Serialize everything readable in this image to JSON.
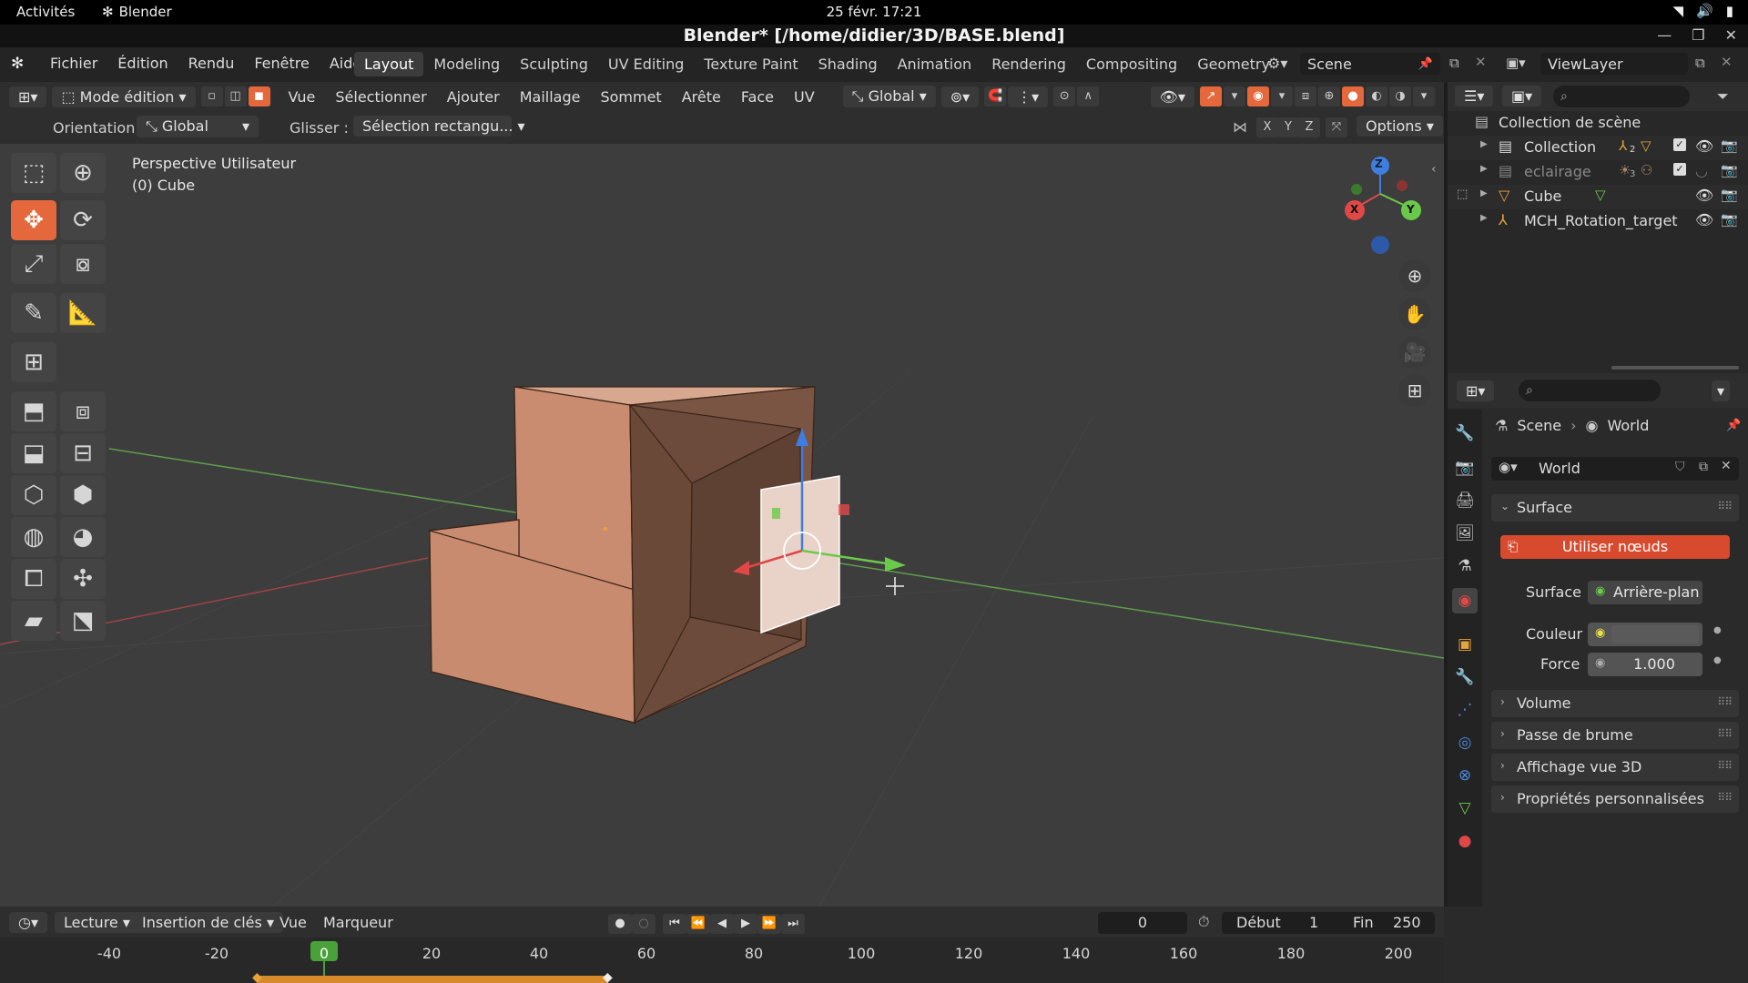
{
  "os_bar": {
    "activities": "Activités",
    "app_name": "Blender",
    "clock": "25 févr.  17:21"
  },
  "window": {
    "title": "Blender* [/home/didier/3D/BASE.blend]"
  },
  "menus": [
    "Fichier",
    "Édition",
    "Rendu",
    "Fenêtre",
    "Aide"
  ],
  "workspaces": [
    "Layout",
    "Modeling",
    "Sculpting",
    "UV Editing",
    "Texture Paint",
    "Shading",
    "Animation",
    "Rendering",
    "Compositing",
    "Geometry Nc"
  ],
  "active_workspace": "Layout",
  "scene_name": "Scene",
  "view_layer": "ViewLayer",
  "viewport_header": {
    "mode": "Mode édition",
    "menus": [
      "Vue",
      "Sélectionner",
      "Ajouter",
      "Maillage",
      "Sommet",
      "Arête",
      "Face",
      "UV"
    ],
    "transform_orientation": "Global"
  },
  "tool_settings": {
    "orientation_label": "Orientation:",
    "orientation_value": "Global",
    "drag_label": "Glisser :",
    "drag_value": "Sélection rectangu...",
    "axes": [
      "X",
      "Y",
      "Z"
    ],
    "options_label": "Options"
  },
  "viewport": {
    "view_name": "Perspective Utilisateur",
    "object_label": "(0) Cube",
    "gizmo_axes": {
      "x": "X",
      "y": "Y",
      "z": "Z"
    }
  },
  "outliner": {
    "root": "Collection de scène",
    "items": [
      {
        "name": "Collection",
        "sub_count": "2"
      },
      {
        "name": "eclairage",
        "sub_count": "3"
      },
      {
        "name": "Cube"
      },
      {
        "name": "MCH_Rotation_target"
      }
    ]
  },
  "properties": {
    "breadcrumb_scene": "Scene",
    "breadcrumb_world": "World",
    "world_name": "World",
    "surface_panel": "Surface",
    "use_nodes_button": "Utiliser nœuds",
    "surface_label": "Surface",
    "surface_value": "Arrière-plan",
    "color_label": "Couleur",
    "color_value": "#d8d8d8",
    "strength_label": "Force",
    "strength_value": "1.000",
    "collapsed_panels": [
      "Volume",
      "Passe de brume",
      "Affichage vue 3D",
      "Propriétés personnalisées"
    ]
  },
  "timeline": {
    "playback": "Lecture",
    "keying": "Insertion de clés",
    "view": "Vue",
    "marker": "Marqueur",
    "current_frame": "0",
    "start_label": "Début",
    "start_value": "1",
    "end_label": "Fin",
    "end_value": "250",
    "ruler_ticks": [
      "-40",
      "-20",
      "0",
      "20",
      "40",
      "60",
      "80",
      "100",
      "120",
      "140",
      "160",
      "180",
      "200"
    ]
  },
  "colors": {
    "accent": "#e4683b",
    "object_orange": "#c98c70",
    "axis_x": "#e04848",
    "axis_y": "#6ac94a",
    "axis_z": "#3f7ee0"
  }
}
